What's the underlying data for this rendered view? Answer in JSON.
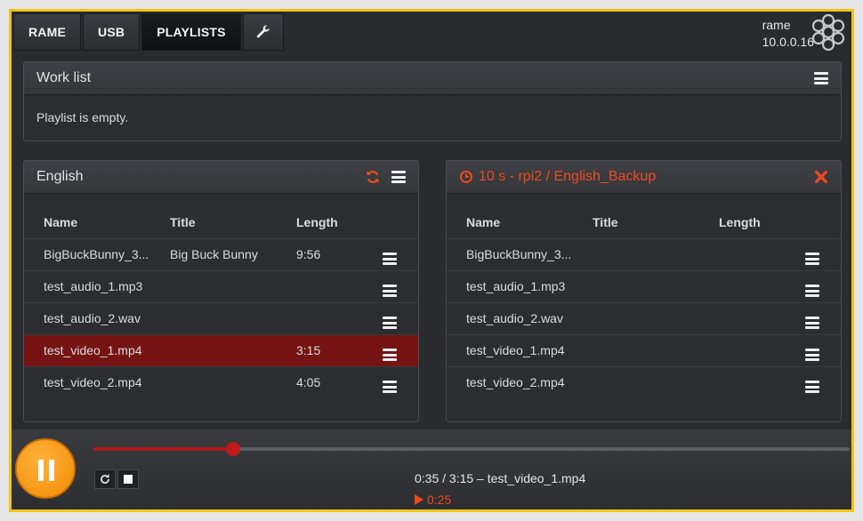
{
  "nav": {
    "tabs": [
      {
        "label": "RAME"
      },
      {
        "label": "USB"
      },
      {
        "label": "PLAYLISTS",
        "active": true
      }
    ]
  },
  "host": {
    "name": "rame",
    "ip": "10.0.0.16"
  },
  "worklist": {
    "title": "Work list",
    "empty_text": "Playlist is empty."
  },
  "left_panel": {
    "title": "English",
    "columns": [
      "Name",
      "Title",
      "Length"
    ],
    "rows": [
      {
        "name": "BigBuckBunny_3...",
        "title": "Big Buck Bunny",
        "length": "9:56",
        "selected": false
      },
      {
        "name": "test_audio_1.mp3",
        "title": "",
        "length": "",
        "selected": false
      },
      {
        "name": "test_audio_2.wav",
        "title": "",
        "length": "",
        "selected": false
      },
      {
        "name": "test_video_1.mp4",
        "title": "",
        "length": "3:15",
        "selected": true
      },
      {
        "name": "test_video_2.mp4",
        "title": "",
        "length": "4:05",
        "selected": false
      }
    ]
  },
  "right_panel": {
    "title": "10 s - rpi2 / English_Backup",
    "columns": [
      "Name",
      "Title",
      "Length"
    ],
    "rows": [
      {
        "name": "BigBuckBunny_3...",
        "title": "",
        "length": ""
      },
      {
        "name": "test_audio_1.mp3",
        "title": "",
        "length": ""
      },
      {
        "name": "test_audio_2.wav",
        "title": "",
        "length": ""
      },
      {
        "name": "test_video_1.mp4",
        "title": "",
        "length": ""
      },
      {
        "name": "test_video_2.mp4",
        "title": "",
        "length": ""
      }
    ]
  },
  "player": {
    "progress_fraction": 0.185,
    "now_playing": "0:35 / 3:15 – test_video_1.mp4",
    "remaining": "0:25"
  },
  "colors": {
    "frame_border": "#f2c417",
    "accent_orange": "#ee4a1c",
    "selected_row": "#761414",
    "play_button": "#f28b05"
  },
  "icons": [
    "wrench-icon",
    "logo-icon",
    "menu-icon",
    "refresh-icon",
    "clock-icon",
    "close-icon",
    "pause-icon",
    "repeat-icon",
    "stop-icon",
    "play-triangle-icon"
  ]
}
